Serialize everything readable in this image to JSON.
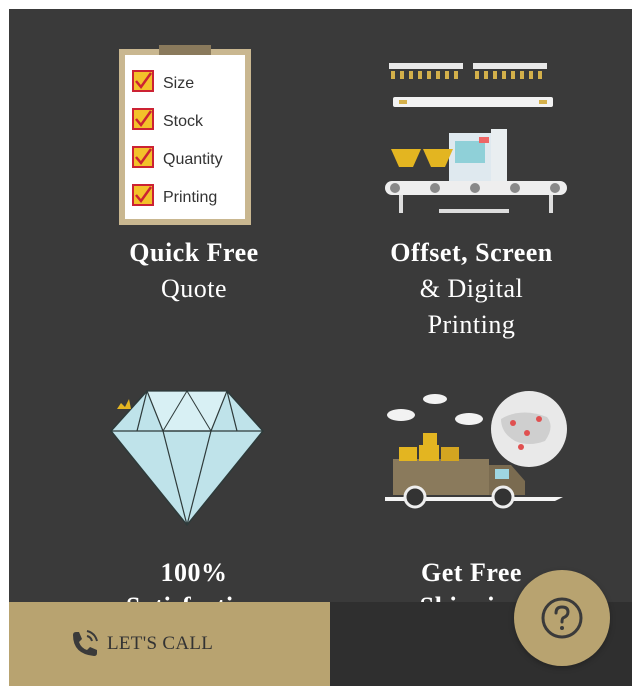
{
  "features": [
    {
      "title": "Quick Free",
      "subtitle_lines": [
        "Quote"
      ],
      "icon": "clipboard-checklist-icon",
      "checklist": [
        "Size",
        "Stock",
        "Quantity",
        "Printing"
      ]
    },
    {
      "title": "Offset, Screen",
      "subtitle_lines": [
        "& Digital",
        "Printing"
      ],
      "icon": "printing-press-icon"
    },
    {
      "title": "100%",
      "subtitle_lines": [
        "Satisfaction"
      ],
      "icon": "diamond-icon"
    },
    {
      "title": "Get Free",
      "subtitle_lines": [
        "Shipping"
      ],
      "icon": "delivery-truck-globe-icon"
    }
  ],
  "call_button": {
    "label": "LET'S CALL",
    "icon": "phone-call-icon"
  },
  "help_button": {
    "icon": "question-mark-icon"
  },
  "colors": {
    "panel_bg": "#3a3a3a",
    "accent_gold": "#b8a370",
    "bottom_bar": "#2f2f2f",
    "text": "#ffffff"
  }
}
